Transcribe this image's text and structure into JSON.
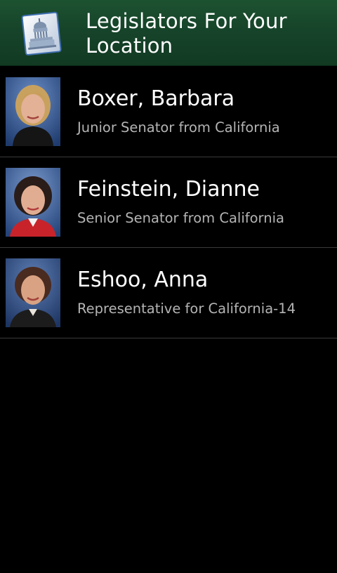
{
  "header": {
    "title": "Legislators For Your Location",
    "icon": "capitol-icon"
  },
  "legislators": [
    {
      "name": "Boxer, Barbara",
      "role": "Junior Senator from California",
      "photo": "portrait-photo"
    },
    {
      "name": "Feinstein, Dianne",
      "role": "Senior Senator from California",
      "photo": "portrait-photo"
    },
    {
      "name": "Eshoo, Anna",
      "role": "Representative for California-14",
      "photo": "portrait-photo"
    }
  ],
  "colors": {
    "title_bar": "#16442a",
    "background": "#000000",
    "name_text": "#ffffff",
    "role_text": "#b4b4b4",
    "divider": "#3a3a3a"
  }
}
